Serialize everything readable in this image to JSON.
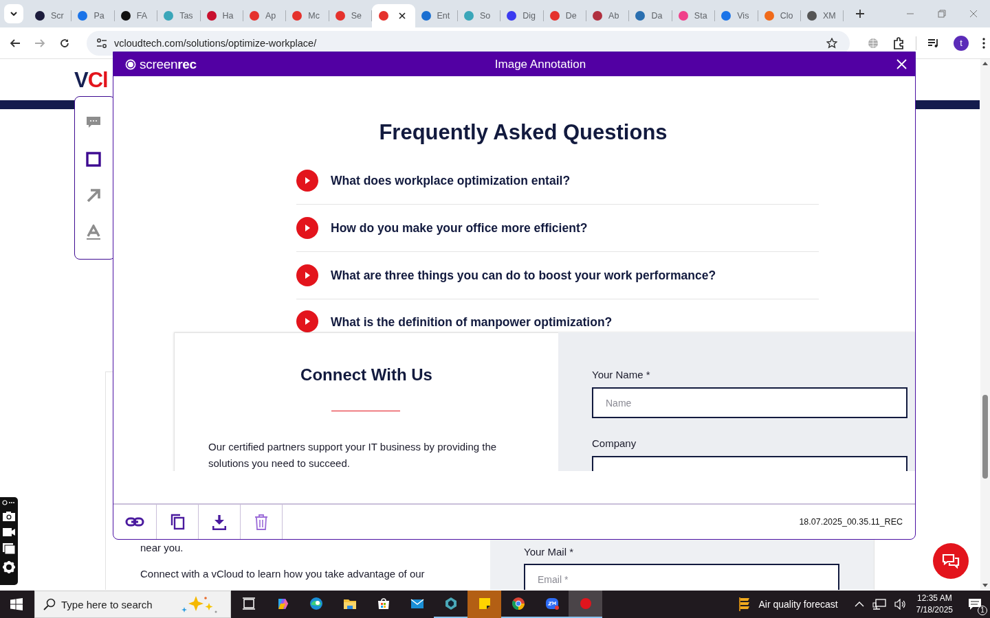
{
  "browser": {
    "tabs": [
      {
        "label": "Scr",
        "color": "#1c1c3c",
        "selected": false
      },
      {
        "label": "Pa",
        "color": "#1a73e8",
        "selected": false
      },
      {
        "label": "FA",
        "color": "#111111",
        "selected": false
      },
      {
        "label": "Tas",
        "color": "#3aa6b9",
        "selected": false
      },
      {
        "label": "Ha",
        "color": "#c8102e",
        "selected": false
      },
      {
        "label": "Ap",
        "color": "#e5322d",
        "selected": false
      },
      {
        "label": "Mc",
        "color": "#e5322d",
        "selected": false
      },
      {
        "label": "Se",
        "color": "#e5322d",
        "selected": false
      },
      {
        "color": "#e5322d",
        "selected": true
      },
      {
        "label": "Ent",
        "color": "#1a6fd1",
        "selected": false
      },
      {
        "label": "So",
        "color": "#3aa6b9",
        "selected": false
      },
      {
        "label": "Dig",
        "color": "#3b3bf0",
        "selected": false
      },
      {
        "label": "De",
        "color": "#e5322d",
        "selected": false
      },
      {
        "label": "Ab",
        "color": "#b0303f",
        "selected": false
      },
      {
        "label": "Da",
        "color": "#2a6fb0",
        "selected": false
      },
      {
        "label": "Sta",
        "color": "#f0408a",
        "selected": false
      },
      {
        "label": "Vis",
        "color": "#1a73e8",
        "selected": false
      },
      {
        "label": "Clo",
        "color": "#f06a1a",
        "selected": false
      },
      {
        "label": "XM",
        "color": "#555555",
        "selected": false
      }
    ],
    "address": "vcloudtech.com/solutions/optimize-workplace/",
    "profile_initial": "t"
  },
  "webpage": {
    "logo": "VCl",
    "tools": [
      {
        "kind": "comment",
        "selected": false
      },
      {
        "kind": "rectangle",
        "selected": true
      },
      {
        "kind": "arrow",
        "selected": false
      },
      {
        "kind": "text",
        "selected": false
      }
    ],
    "body_lines": [
      "near you.",
      "Connect with a vCloud to learn how you take advantage of our"
    ],
    "mail_label": "Your Mail *",
    "mail_placeholder": "Email *"
  },
  "annotation": {
    "brand": "screen**rec**",
    "title": "Image Annotation",
    "faq_title": "Frequently Asked Questions",
    "questions": [
      "What does workplace optimization entail?",
      "How do you make your office more efficient?",
      "What are three things you can do to boost your work performance?",
      "What is the definition of manpower optimization?"
    ],
    "connect_title": "Connect With Us",
    "connect_text": "Our certified partners support your IT business by providing the solutions you need to succeed.",
    "name_label": "Your Name *",
    "name_placeholder": "Name",
    "company_label": "Company",
    "actions": [
      {
        "kind": "link"
      },
      {
        "kind": "copy"
      },
      {
        "kind": "download"
      },
      {
        "kind": "delete"
      }
    ],
    "file_name": "18.07.2025_00.35.11_REC"
  },
  "taskbar": {
    "search_placeholder": "Type here to search",
    "apps": [
      {
        "kind": "taskview",
        "running": false,
        "active": false,
        "attention": false
      },
      {
        "kind": "copilot",
        "running": false,
        "active": false,
        "attention": false
      },
      {
        "kind": "edge",
        "running": false,
        "active": false,
        "attention": false
      },
      {
        "kind": "explorer",
        "running": false,
        "active": false,
        "attention": false
      },
      {
        "kind": "store",
        "running": false,
        "active": false,
        "attention": false
      },
      {
        "kind": "mail",
        "running": false,
        "active": false,
        "attention": false
      },
      {
        "kind": "hexagon",
        "running": true,
        "active": false,
        "attention": false
      },
      {
        "kind": "notes",
        "running": false,
        "active": false,
        "attention": true
      },
      {
        "kind": "chrome",
        "running": true,
        "active": false,
        "attention": false
      },
      {
        "kind": "zoom",
        "running": true,
        "active": false,
        "attention": false
      },
      {
        "kind": "recorder",
        "running": true,
        "active": true,
        "attention": false
      }
    ],
    "weather": "Air quality forecast",
    "time": "12:35 AM",
    "date": "7/18/2025",
    "notifications": "1"
  }
}
